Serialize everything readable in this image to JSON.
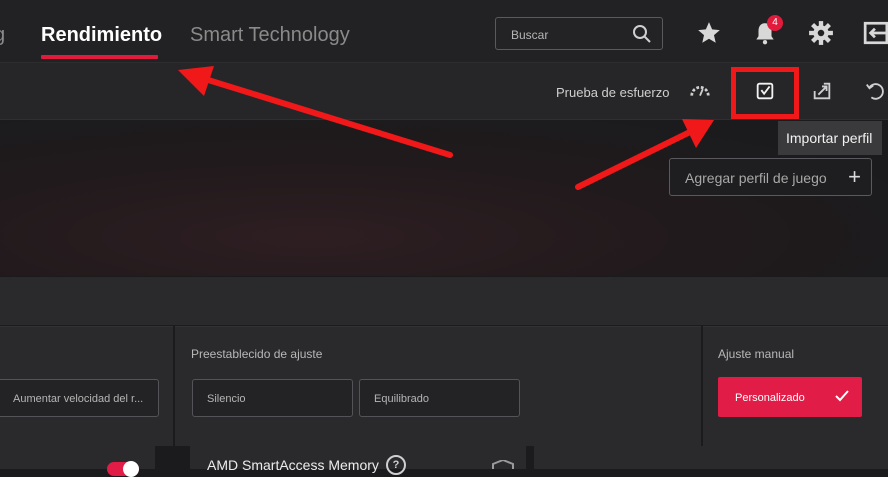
{
  "header": {
    "tab_prev_partial": "g",
    "tab_active": "Rendimiento",
    "tab_smart": "Smart Technology",
    "search_placeholder": "Buscar",
    "notification_count": "4",
    "icons": [
      "star-icon",
      "bell-icon",
      "gear-icon",
      "exit-window-icon"
    ]
  },
  "subbar": {
    "stress_test_label": "Prueba de esfuerzo",
    "icons": [
      "gauge-icon",
      "import-profile-icon",
      "export-icon",
      "reset-icon"
    ]
  },
  "tooltip": {
    "import_profile": "Importar perfil"
  },
  "add_game_profile": {
    "label": "Agregar perfil de juego",
    "icon": "+"
  },
  "tuning": {
    "left_option": "Aumentar velocidad del r...",
    "preset_title": "Preestablecido de ajuste",
    "presets": [
      "Silencio",
      "Equilibrado"
    ],
    "manual_title": "Ajuste manual",
    "manual_button": "Personalizado"
  },
  "bottom": {
    "sam_label": "AMD SmartAccess Memory",
    "help": "?",
    "toggle_on": true
  },
  "colors": {
    "accent": "#e21b3c",
    "annotation": "#f01818",
    "background": "#1b1b1d"
  }
}
